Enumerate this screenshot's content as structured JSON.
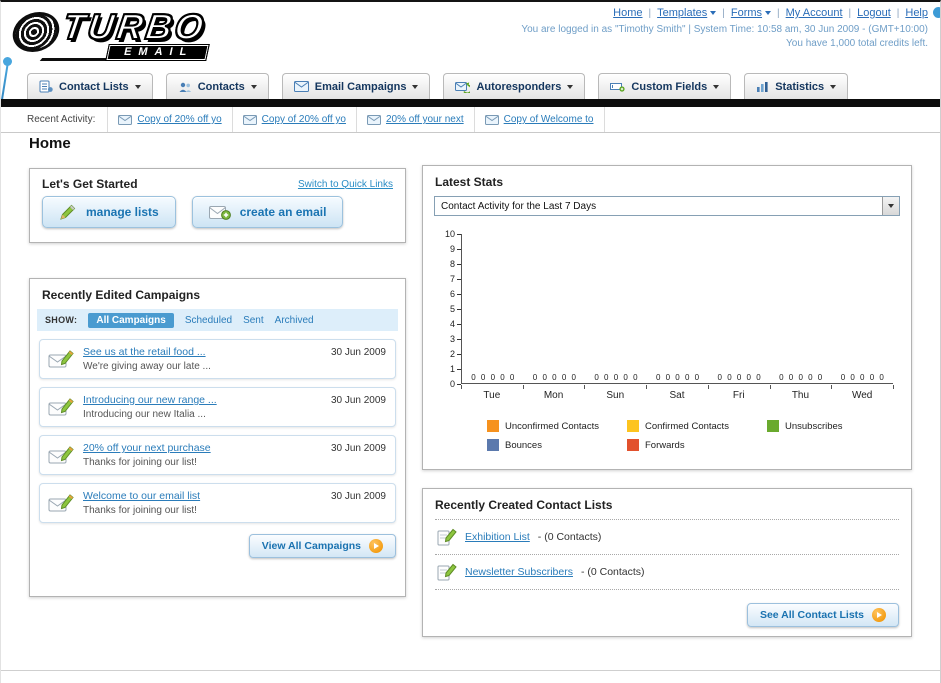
{
  "header": {
    "logo_title": "TURBO",
    "logo_subtitle": "EMAIL",
    "links": [
      {
        "label": "Home",
        "dropdown": false
      },
      {
        "label": "Templates",
        "dropdown": true
      },
      {
        "label": "Forms",
        "dropdown": true
      },
      {
        "label": "My Account",
        "dropdown": false
      },
      {
        "label": "Logout",
        "dropdown": false
      },
      {
        "label": "Help",
        "dropdown": false
      }
    ],
    "login_info": "You are logged in as \"Timothy Smith\" | System Time: 10:58 am, 30 Jun 2009 - (GMT+10:00)",
    "credits_info": "You have 1,000 total credits left."
  },
  "nav": {
    "tabs": [
      {
        "label": "Contact Lists",
        "icon": "contact-lists-icon"
      },
      {
        "label": "Contacts",
        "icon": "contacts-icon"
      },
      {
        "label": "Email Campaigns",
        "icon": "email-campaigns-icon"
      },
      {
        "label": "Autoresponders",
        "icon": "autoresponders-icon"
      },
      {
        "label": "Custom Fields",
        "icon": "custom-fields-icon"
      },
      {
        "label": "Statistics",
        "icon": "statistics-icon"
      }
    ]
  },
  "recent_activity": {
    "label": "Recent Activity:",
    "items": [
      {
        "label": "Copy of 20% off yo"
      },
      {
        "label": "Copy of 20% off yo"
      },
      {
        "label": "20% off your next"
      },
      {
        "label": "Copy of Welcome to"
      }
    ]
  },
  "page": {
    "title": "Home"
  },
  "get_started": {
    "title": "Let's Get Started",
    "switch_link": "Switch to Quick Links",
    "manage_lists_label": "manage lists",
    "create_email_label": "create an email"
  },
  "campaigns": {
    "title": "Recently Edited Campaigns",
    "show_label": "SHOW:",
    "tabs": [
      {
        "label": "All Campaigns",
        "selected": true
      },
      {
        "label": "Scheduled",
        "selected": false
      },
      {
        "label": "Sent",
        "selected": false
      },
      {
        "label": "Archived",
        "selected": false
      }
    ],
    "items": [
      {
        "title": "See us at the retail food ...",
        "subtitle": "We're giving away our late ...",
        "date": "30 Jun 2009"
      },
      {
        "title": "Introducing our new range ...",
        "subtitle": "Introducing our new Italia ...",
        "date": "30 Jun 2009"
      },
      {
        "title": "20% off your next purchase",
        "subtitle": "Thanks for joining our list!",
        "date": "30 Jun 2009"
      },
      {
        "title": "Welcome to our email list",
        "subtitle": "Thanks for joining our list!",
        "date": "30 Jun 2009"
      }
    ],
    "view_all_label": "View All Campaigns"
  },
  "stats": {
    "title": "Latest Stats",
    "dropdown_value": "Contact Activity for the Last 7 Days",
    "chart_data": {
      "type": "bar",
      "title": "Contact Activity for the Last 7 Days",
      "categories": [
        "Tue",
        "Mon",
        "Sun",
        "Sat",
        "Fri",
        "Thu",
        "Wed"
      ],
      "series": [
        {
          "name": "Unconfirmed Contacts",
          "color": "#f6921e",
          "values": [
            0,
            0,
            0,
            0,
            0,
            0,
            0
          ]
        },
        {
          "name": "Confirmed Contacts",
          "color": "#fdc41f",
          "values": [
            0,
            0,
            0,
            0,
            0,
            0,
            0
          ]
        },
        {
          "name": "Unsubscribes",
          "color": "#6aaa2e",
          "values": [
            0,
            0,
            0,
            0,
            0,
            0,
            0
          ]
        },
        {
          "name": "Bounces",
          "color": "#5b79ad",
          "values": [
            0,
            0,
            0,
            0,
            0,
            0,
            0
          ]
        },
        {
          "name": "Forwards",
          "color": "#e2512d",
          "values": [
            0,
            0,
            0,
            0,
            0,
            0,
            0
          ]
        }
      ],
      "ylim": [
        0,
        10
      ],
      "y_tick_step": 1,
      "grid": false,
      "legend_position": "bottom"
    }
  },
  "contact_lists": {
    "title": "Recently Created Contact Lists",
    "items": [
      {
        "name": "Exhibition List",
        "detail": "- (0 Contacts)"
      },
      {
        "name": "Newsletter Subscribers",
        "detail": "- (0 Contacts)"
      }
    ],
    "see_all_label": "See All Contact Lists"
  }
}
